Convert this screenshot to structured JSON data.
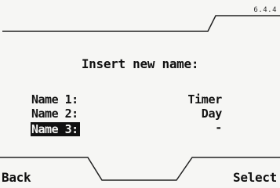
{
  "header": {
    "version": "6.4.4"
  },
  "dialog": {
    "title": "Insert new name:"
  },
  "rows": [
    {
      "label": "Name 1:",
      "value": "Timer"
    },
    {
      "label": "Name 2:",
      "value": "Day"
    },
    {
      "label": "Name 3:",
      "value": "-"
    }
  ],
  "softkeys": {
    "left": "Back",
    "right": "Select"
  }
}
